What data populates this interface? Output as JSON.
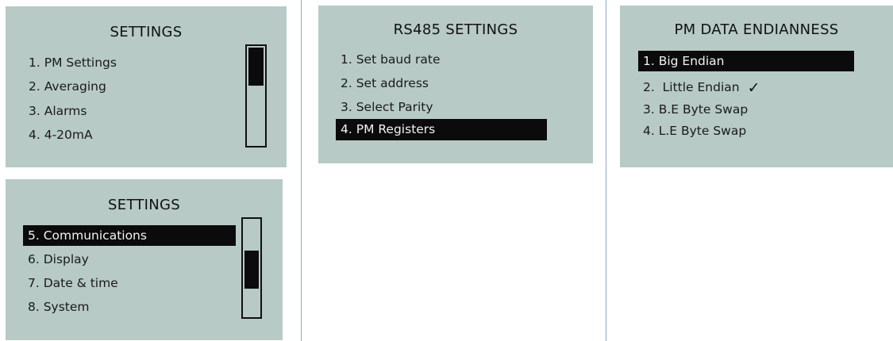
{
  "screens": {
    "settings_page1": {
      "title": "SETTINGS",
      "items": [
        {
          "label": "1. PM Settings"
        },
        {
          "label": "2. Averaging"
        },
        {
          "label": "3. Alarms"
        },
        {
          "label": "4. 4-20mA"
        }
      ],
      "scroll_position": "top",
      "selected_index": null
    },
    "settings_page2": {
      "title": "SETTINGS",
      "items": [
        {
          "label": "5. Communications"
        },
        {
          "label": "6. Display"
        },
        {
          "label": "7. Date & time"
        },
        {
          "label": "8. System"
        }
      ],
      "scroll_position": "middle",
      "selected_index": 0
    },
    "rs485_settings": {
      "title": "RS485 SETTINGS",
      "items": [
        {
          "label": "1. Set baud rate"
        },
        {
          "label": "2. Set address"
        },
        {
          "label": "3. Select Parity"
        },
        {
          "label": "4. PM Registers"
        }
      ],
      "selected_index": 3
    },
    "pm_data_endianness": {
      "title": "PM DATA ENDIANNESS",
      "items": [
        {
          "label": "1. Big Endian"
        },
        {
          "label": "2.  Little Endian",
          "check": "✓"
        },
        {
          "label": "3. B.E Byte Swap"
        },
        {
          "label": "4. L.E Byte Swap"
        }
      ],
      "selected_index": 0,
      "checked_index": 1
    }
  },
  "colors": {
    "screen_background": "#b7cac6",
    "highlight_background": "#0b0b0b",
    "highlight_text": "#f2f2f2",
    "divider": "#8ea8c8"
  }
}
